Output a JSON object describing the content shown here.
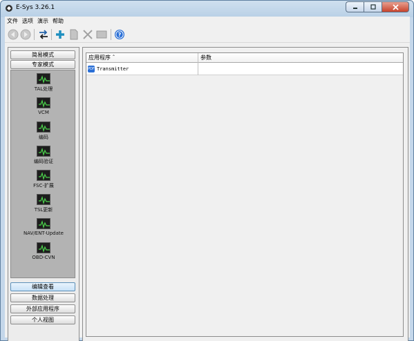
{
  "window": {
    "title": "E-Sys 3.26.1"
  },
  "menu": [
    "文件",
    "选项",
    "演示",
    "帮助"
  ],
  "toolbar": {
    "buttons": [
      "back-icon",
      "forward-icon",
      "connect-icon",
      "add-icon",
      "document-icon",
      "cut-icon",
      "window-icon",
      "help-icon"
    ]
  },
  "nav": {
    "simple_mode": "简易模式",
    "expert_mode": "专家模式",
    "tools": [
      "TAL处理",
      "VCM",
      "编码",
      "编码验证",
      "FSC-扩展",
      "TSL更新",
      "NAV/ENT-Update",
      "OBD-CVN"
    ],
    "bottom": [
      "编辑查看",
      "数据处理",
      "外部应用程序",
      "个人视图"
    ],
    "active_bottom": "编辑查看"
  },
  "table": {
    "columns": [
      "应用程序 ˆ",
      "参数"
    ],
    "rows": [
      {
        "app": "Transmitter",
        "param": ""
      }
    ],
    "row_icon_label": "PDF"
  },
  "colors": {
    "panel_gray": "#b3b3b3",
    "accent_blue": "#2a6fd6",
    "active_nav": "#c8e2f7"
  }
}
